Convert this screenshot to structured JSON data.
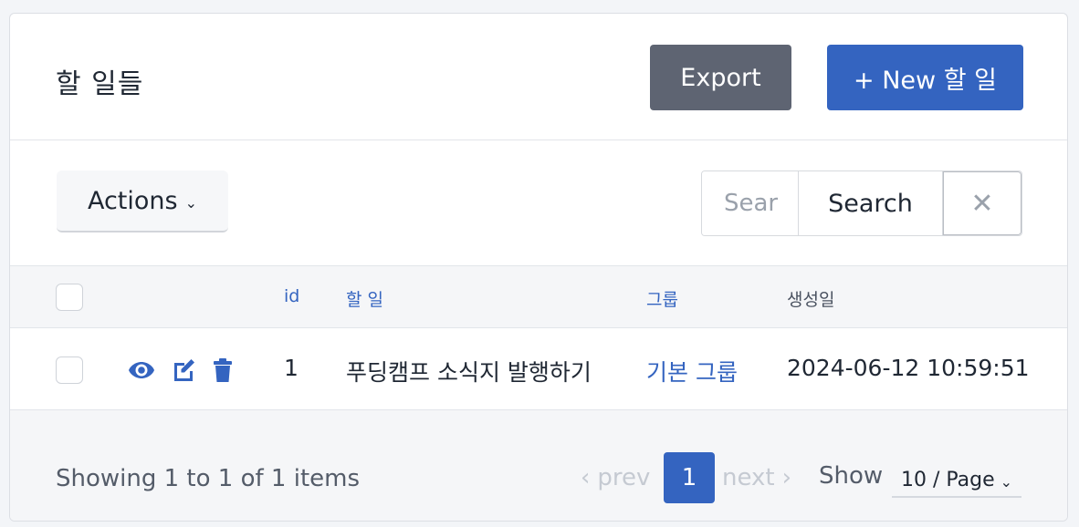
{
  "header": {
    "title": "할 일들",
    "export_label": "Export",
    "new_label": "+ New 할 일"
  },
  "toolbar": {
    "actions_label": "Actions",
    "search_placeholder": "Sear",
    "search_label": "Search",
    "clear_label": "✕"
  },
  "table": {
    "columns": [
      "id",
      "할 일",
      "그룹",
      "생성일"
    ],
    "rows": [
      {
        "id": "1",
        "todo": "푸딩캠프 소식지 발행하기",
        "group": "기본 그룹",
        "created": "2024-06-12 10:59:51"
      }
    ]
  },
  "footer": {
    "showing": "Showing 1 to 1 of 1 items",
    "prev": "prev",
    "next": "next",
    "current_page": "1",
    "show_label": "Show",
    "page_size": "10 / Page"
  },
  "colors": {
    "primary": "#3464c0",
    "export": "#5e6472",
    "disabled": "#c5cad2"
  },
  "icons": {
    "view": "eye-icon",
    "edit": "edit-icon",
    "delete": "trash-icon"
  }
}
